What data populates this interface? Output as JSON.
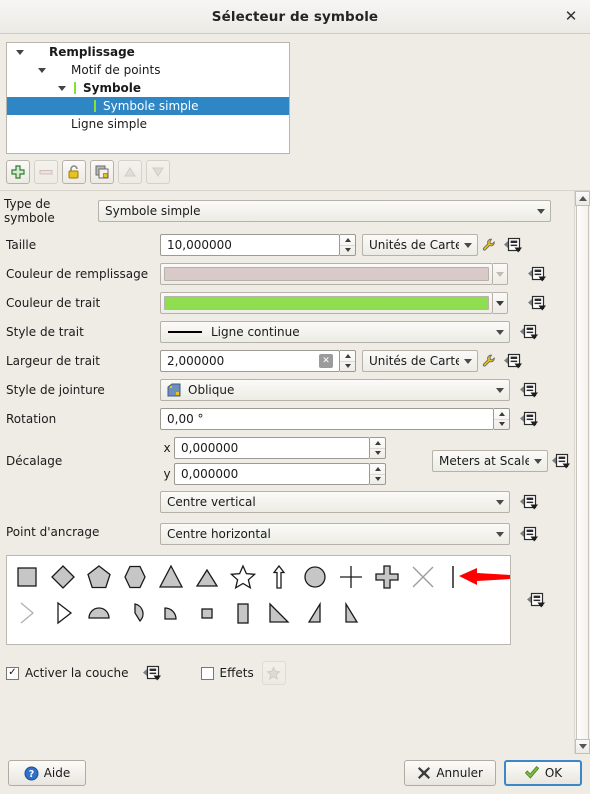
{
  "window": {
    "title": "Sélecteur de symbole",
    "close_icon": "close-icon"
  },
  "layer_tree": {
    "rows": [
      {
        "label": "Remplissage",
        "indent": 0,
        "bold": true,
        "expander": true,
        "swatch": false,
        "selected": false
      },
      {
        "label": "Motif de points",
        "indent": 1,
        "bold": false,
        "expander": true,
        "swatch": false,
        "selected": false
      },
      {
        "label": "Symbole",
        "indent": 2,
        "bold": true,
        "expander": true,
        "swatch": true,
        "selected": false
      },
      {
        "label": "Symbole simple",
        "indent": 3,
        "bold": false,
        "expander": false,
        "swatch": true,
        "selected": true
      },
      {
        "label": "Ligne simple",
        "indent": 1,
        "bold": false,
        "expander": false,
        "swatch": false,
        "selected": false
      }
    ],
    "swatch_color": "#86e038",
    "selection_color": "#2f86c5"
  },
  "toolbar": {
    "buttons": [
      {
        "name": "add-symbol-layer-button",
        "icon": "plus-icon",
        "enabled": true
      },
      {
        "name": "remove-symbol-layer-button",
        "icon": "minus-icon",
        "enabled": false
      },
      {
        "name": "lock-layer-colors-button",
        "icon": "padlock-icon",
        "enabled": true
      },
      {
        "name": "duplicate-symbol-layer-button",
        "icon": "duplicate-icon",
        "enabled": true
      },
      {
        "name": "move-layer-up-button",
        "icon": "arrow-up-icon",
        "enabled": false
      },
      {
        "name": "move-layer-down-button",
        "icon": "arrow-down-icon",
        "enabled": false
      }
    ]
  },
  "form": {
    "symbol_type": {
      "label": "Type de symbole",
      "value": "Symbole simple"
    },
    "size": {
      "label": "Taille",
      "value": "10,000000",
      "unit": "Unités de Carte"
    },
    "fill_color": {
      "label": "Couleur de remplissage",
      "value": "#d9c9c9"
    },
    "stroke_color": {
      "label": "Couleur de trait",
      "value": "#8ede4f"
    },
    "stroke_style": {
      "label": "Style de trait",
      "value": "Ligne continue"
    },
    "stroke_width": {
      "label": "Largeur de trait",
      "value": "2,000000",
      "unit": "Unités de Carte"
    },
    "join_style": {
      "label": "Style de jointure",
      "value": "Oblique"
    },
    "rotation": {
      "label": "Rotation",
      "value": "0,00 °"
    },
    "offset": {
      "label": "Décalage",
      "x_label": "x",
      "x_value": "0,000000",
      "y_label": "y",
      "y_value": "0,000000",
      "unit": "Meters at Scale"
    },
    "anchor_point": {
      "label": "Point d'ancrage",
      "vertical": "Centre vertical",
      "horizontal": "Centre horizontal"
    }
  },
  "symbol_grid": {
    "rows": [
      [
        {
          "name": "shape-square",
          "icon": "square-icon"
        },
        {
          "name": "shape-diamond",
          "icon": "diamond-icon"
        },
        {
          "name": "shape-pentagon",
          "icon": "pentagon-icon"
        },
        {
          "name": "shape-hexagon",
          "icon": "hexagon-icon"
        },
        {
          "name": "shape-triangle",
          "icon": "triangle-icon"
        },
        {
          "name": "shape-equilateral-triangle",
          "icon": "equilateral-triangle-icon"
        },
        {
          "name": "shape-star",
          "icon": "star-icon"
        },
        {
          "name": "shape-arrow",
          "icon": "arrow-up-outline-icon"
        },
        {
          "name": "shape-circle",
          "icon": "circle-icon"
        },
        {
          "name": "shape-cross",
          "icon": "cross-thin-icon"
        },
        {
          "name": "shape-cross-fill",
          "icon": "cross-fill-icon"
        },
        {
          "name": "shape-x",
          "icon": "x-icon"
        },
        {
          "name": "shape-line",
          "icon": "vertical-line-icon"
        }
      ],
      [
        {
          "name": "shape-arrow-head",
          "icon": "chevron-right-icon"
        },
        {
          "name": "shape-filled-arrowhead",
          "icon": "triangle-right-icon"
        },
        {
          "name": "shape-half-disc",
          "icon": "half-disc-icon"
        },
        {
          "name": "shape-third-disc",
          "icon": "third-disc-icon"
        },
        {
          "name": "shape-quarter-disc",
          "icon": "quarter-disc-icon"
        },
        {
          "name": "shape-quarter-square",
          "icon": "quarter-square-icon"
        },
        {
          "name": "shape-half-square",
          "icon": "half-square-icon"
        },
        {
          "name": "shape-diagonal-half-square",
          "icon": "diagonal-half-square-icon"
        },
        {
          "name": "shape-right-half-triangle",
          "icon": "right-half-triangle-icon"
        },
        {
          "name": "shape-left-half-triangle",
          "icon": "left-half-triangle-icon"
        }
      ]
    ],
    "annotation": {
      "name": "red-arrow-annotation",
      "color": "#ff0000",
      "points_to": "shape-line"
    }
  },
  "footer": {
    "enable_layer": {
      "label": "Activer la couche",
      "checked": true
    },
    "effects": {
      "label": "Effets",
      "checked": false
    },
    "help_button": {
      "label": "Aide",
      "icon": "help-icon"
    },
    "cancel_button": {
      "label": "Annuler",
      "icon": "x-mark-icon"
    },
    "ok_button": {
      "label": "OK",
      "icon": "check-icon"
    }
  }
}
